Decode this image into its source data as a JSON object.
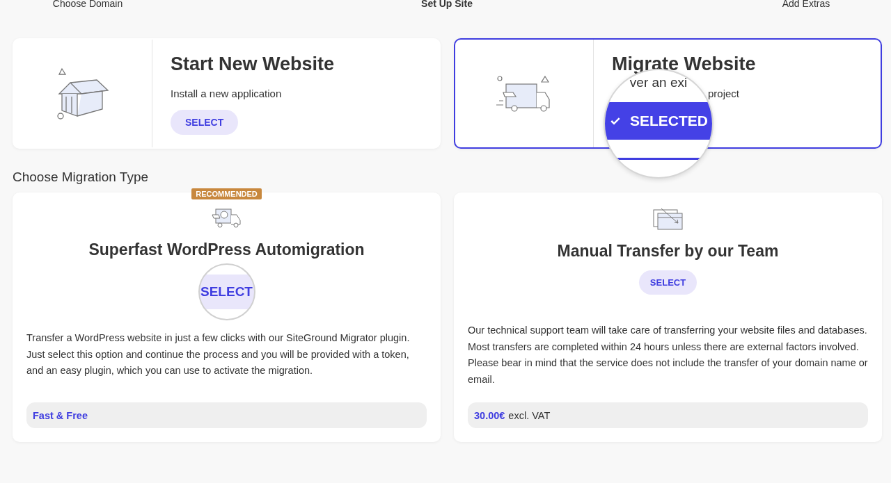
{
  "steps": [
    {
      "label": "Choose Domain",
      "selected": false
    },
    {
      "label": "Set Up Site",
      "selected": true
    },
    {
      "label": "Add Extras",
      "selected": false
    }
  ],
  "project_types": [
    {
      "kind": "new",
      "title": "Start New Website",
      "description": "Install a new application",
      "button": "SELECT",
      "selected": false
    },
    {
      "kind": "migrate",
      "title": "Migrate Website",
      "description_end": "project",
      "magnifier": {
        "text": "ver an exi",
        "button": "SELECTED"
      },
      "selected": true
    }
  ],
  "section_title": "Choose Migration Type",
  "migration_types": [
    {
      "kind": "auto",
      "badge": "RECOMMENDED",
      "title": "Superfast WordPress Automigration",
      "button": "SELECT",
      "magnified": true,
      "description": "Transfer a WordPress website in just a few clicks with our SiteGround Migrator plugin. Just select this option and continue the process and you will be provided with a token, and an easy plugin, which you can use to activate the migration.",
      "price": "Fast & Free"
    },
    {
      "kind": "manual",
      "title": "Manual Transfer by our Team",
      "button": "SELECT",
      "magnified": false,
      "description": "Our technical support team will take care of transferring your website files and databases. Most transfers are completed within 24 hours unless there are external factors involved. Please bear in mind that the service does not include the transfer of your domain name or email.",
      "price": "30.00€",
      "price_note": "excl. VAT"
    }
  ]
}
